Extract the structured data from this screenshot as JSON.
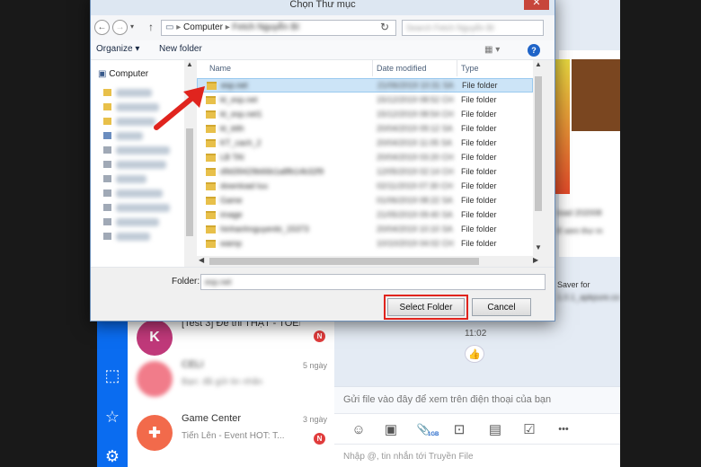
{
  "dialog": {
    "title": "Chọn Thư mục",
    "close_glyph": "✕",
    "address": {
      "path_root": "Computer",
      "path_child": "Fetch Nguyễn Bí",
      "path_separator": "▸"
    },
    "search_placeholder": "Search Fetch Nguyễn Bí",
    "commands": {
      "organize": "Organize ▾",
      "new_folder": "New folder"
    },
    "nav_tree": {
      "root": "Computer"
    },
    "columns": {
      "name": "Name",
      "date": "Date modified",
      "type": "Type"
    },
    "files": [
      {
        "name": "esp.net",
        "date": "21/06/2019 10:31 SA",
        "type": "File folder",
        "selected": true
      },
      {
        "name": "kt_esp.net",
        "date": "15/12/2019 08:52 CH",
        "type": "File folder"
      },
      {
        "name": "kt_esp.net1",
        "date": "15/12/2019 08:54 CH",
        "type": "File folder"
      },
      {
        "name": "kt_ktth",
        "date": "20/04/2019 09:12 SA",
        "type": "File folder"
      },
      {
        "name": "KT_cach_2",
        "date": "20/04/2019 11:05 SA",
        "type": "File folder"
      },
      {
        "name": "LB TAI",
        "date": "20/04/2019 03:20 CH",
        "type": "File folder"
      },
      {
        "name": "d9d39429b66b1a8fb14b32f9",
        "date": "12/05/2019 02:14 CH",
        "type": "File folder"
      },
      {
        "name": "download luu",
        "date": "02/11/2019 07:30 CH",
        "type": "File folder"
      },
      {
        "name": "Game",
        "date": "01/06/2019 08:22 SA",
        "type": "File folder"
      },
      {
        "name": "image",
        "date": "21/05/2019 09:40 SA",
        "type": "File folder"
      },
      {
        "name": "hinhanhnguyenbi_15373",
        "date": "20/04/2019 10:10 SA",
        "type": "File folder"
      },
      {
        "name": "wamp",
        "date": "10/10/2019 04:02 CH",
        "type": "File folder"
      }
    ],
    "folder_label": "Folder:",
    "folder_value": "esp.net",
    "select_button": "Select Folder",
    "cancel_button": "Cancel"
  },
  "chat_list": [
    {
      "avatar": "K",
      "title": "[Test 3] Đề thi THẬT - TOEI...",
      "time": "",
      "sub": "",
      "badge": "N",
      "avatar_color": "#c0397a"
    },
    {
      "avatar": "",
      "title": "CELI",
      "time": "5 ngày",
      "sub": "Bạn: đã gửi tin nhắn",
      "badge": "",
      "avatar_color": "#f17c8a"
    },
    {
      "avatar": "✚",
      "title": "Game Center",
      "time": "3 ngày",
      "sub": "Tiến Lên - Event HOT: T...",
      "badge": "N",
      "avatar_color": "#f26a4b"
    }
  ],
  "chat": {
    "snippets": [
      "load 202008",
      "ể xem thư m",
      "Saver for",
      "1.0.1_apkpure.co"
    ],
    "time": "11:02",
    "hint": "Gửi file vào đây để xem trên điện thoại của bạn",
    "input_placeholder": "Nhập @, tin nhắn tới Truyền File",
    "tool_icons": {
      "sticker": "☺",
      "image": "▣",
      "attach": "📎",
      "size_label": "1GB",
      "screenshot": "⊡",
      "contact": "▤",
      "todo": "☑",
      "more": "•••"
    },
    "like_glyph": "👍"
  },
  "nav_icons": {
    "screen": "⬚",
    "star": "☆",
    "gear": "⚙"
  }
}
